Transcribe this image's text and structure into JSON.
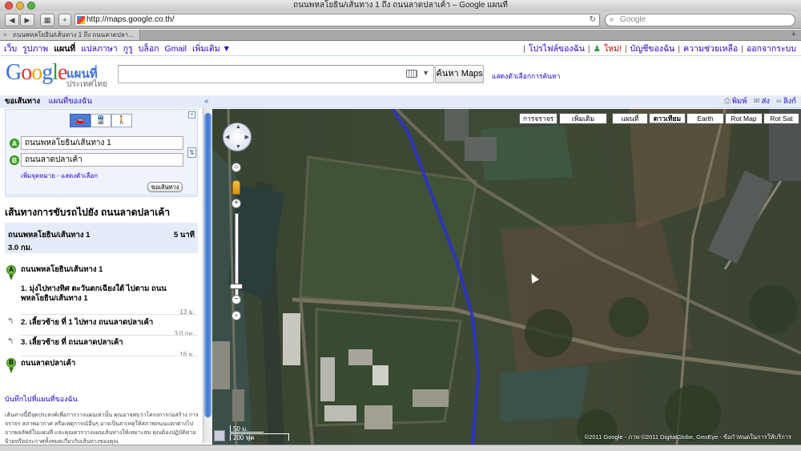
{
  "window": {
    "title": "ถนนพหลโยธิน/เส้นทาง 1 ถึง ถนนลาดปลาเค้า – Google แผนที่"
  },
  "browser": {
    "url": "http://maps.google.co.th/",
    "search_placeholder": "Google",
    "tab_title": "ถนนพหลโยธิน/เส้นทาง 1 ถึง ถนนลาดปลา...",
    "back": "◀",
    "forward": "▶",
    "reload": "↻",
    "add": "+",
    "tabplus": "+"
  },
  "gnav": {
    "left": [
      "เว็บ",
      "รูปภาพ",
      "แผนที่",
      "แปลภาษา",
      "กูรู",
      "บล็อก",
      "Gmail",
      "เพิ่มเติม ▼"
    ],
    "current_index": 2,
    "right": [
      "โปรไฟล์ของฉัน",
      "ใหม่!",
      "บัญชีของฉัน",
      "ความช่วยเหลือ",
      "ออกจากระบบ"
    ]
  },
  "header": {
    "logo_sub": "แผนที่",
    "logo_country": "ประเทศไทย",
    "search_button": "ค้นหา Maps",
    "search_options": "แสดงตัวเลือกการค้นหา"
  },
  "left_panel": {
    "tab_directions": "ขอเส้นทาง",
    "tab_mymaps": "แผนที่ของฉัน",
    "collapse": "«",
    "close": "×",
    "modes": [
      "🚗",
      "🚆",
      "🚶"
    ],
    "from_label": "A",
    "to_label": "B",
    "from_value": "ถนนพหลโยธิน/เส้นทาง 1",
    "to_value": "ถนนลาดปลาเค้า",
    "add_links": "เพิ่มจุดหมาย - แสดงตัวเลือก",
    "get_directions": "ขอเส้นทาง",
    "route_title": "เส้นทางการขับรถไปยัง ถนนลาดปลาเค้า",
    "summary_name": "ถนนพหลโยธิน/เส้นทาง 1",
    "summary_time": "5 นาที",
    "summary_dist": "3.0 กม.",
    "start_name": "ถนนพหลโยธิน/เส้นทาง 1",
    "steps": [
      {
        "num": "1.",
        "text": "มุ่งไปทางทิศ ตะวันตกเฉียงใต้ ไปตาม ถนน",
        "text2": "พหลโยธิน/เส้นทาง 1",
        "dist": "13 ม."
      },
      {
        "num": "2.",
        "text": "เลี้ยวซ้าย ที่ 1 ไปทาง ถนนลาดปลาเค้า",
        "dist": "3.0 กม."
      },
      {
        "num": "3.",
        "text": "เลี้ยวซ้าย ที่ ถนนลาดปลาเค้า",
        "dist": "16 ม."
      }
    ],
    "end_name": "ถนนลาดปลาเค้า",
    "save_link": "บันทึกไปที่แผนที่ของฉัน",
    "disclaimer": "เส้นทางนี้มีจุดประสงค์เพื่อการวางแผนเท่านั้น คุณอาจพบว่าโครงการก่อสร้าง การจราจร สภาพอากาศ หรือเหตุการณ์อื่นๆ อาจเป็นสาเหตุให้สภาพถนนแตกต่างไปจากผลลัพธ์ในแผนที่ และคุณควรวางแผนเส้นทางให้เหมาะสม คุณต้องปฏิบัติตามป้ายหรือประกาศทั้งหมดเกี่ยวกับเส้นทางของคุณ"
  },
  "map_header": {
    "print": "พิมพ์",
    "send": "ส่ง",
    "link": "ลิงก์"
  },
  "map": {
    "types": [
      "การจราจร",
      "เพิ่มเติม",
      "แผนที่",
      "ดาวเทียม",
      "Earth",
      "Rot Map",
      "Rot Sat"
    ],
    "selected_type": "ดาวเทียม",
    "scale_metric": "50 ม.",
    "scale_imperial": "200 ฟุต",
    "copyright": "©2011 Google - ภาพ ©2011 DigitalGlobe, GeoEye - ข้อกำหนดในการให้บริการ",
    "route_color": "#2a33c8"
  }
}
